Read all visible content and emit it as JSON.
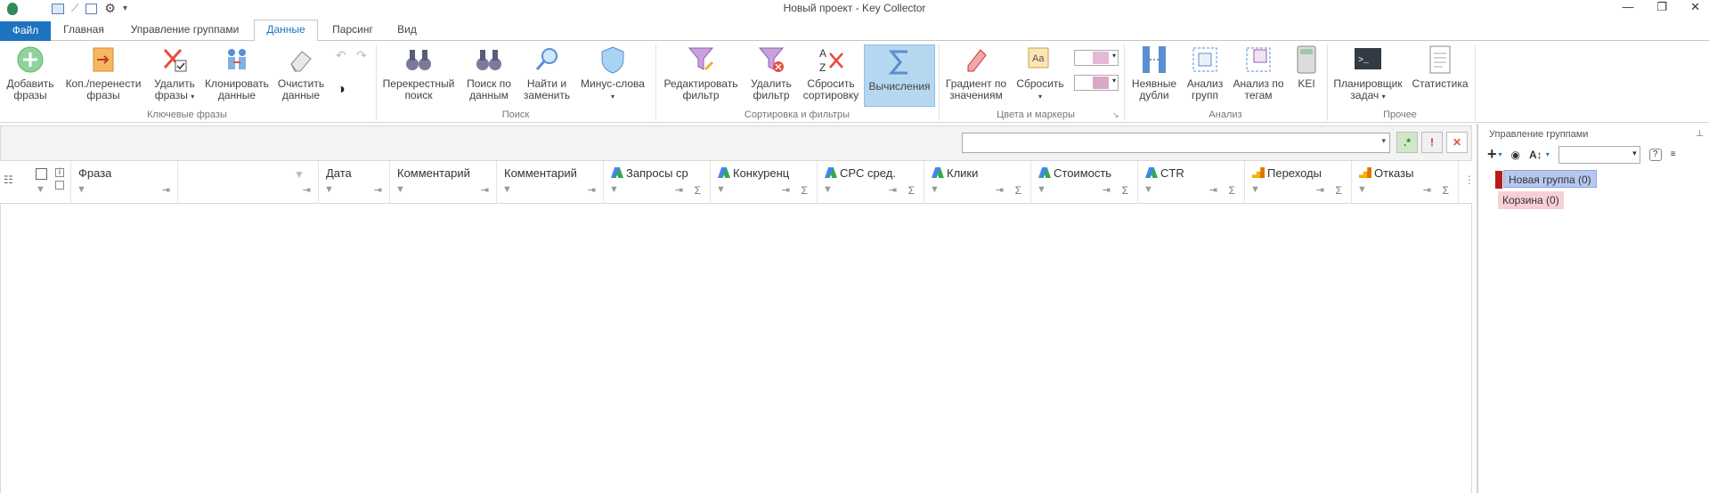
{
  "window": {
    "title": "Новый проект - Key Collector",
    "controls": [
      "—",
      "❐",
      "✕"
    ]
  },
  "tabs": [
    "Файл",
    "Главная",
    "Управление группами",
    "Данные",
    "Парсинг",
    "Вид"
  ],
  "ribbon": {
    "buttons": [
      {
        "label": "Добавить фразы",
        "icon": "add-icon"
      },
      {
        "label": "Коп./перенести фразы",
        "icon": "copy-move-icon"
      },
      {
        "label": "Удалить фразы",
        "icon": "delete-icon"
      },
      {
        "label": "Клонировать данные",
        "icon": "clone-icon"
      },
      {
        "label": "Очистить данные",
        "icon": "eraser-icon"
      },
      {
        "label": "Перекрестный поиск",
        "icon": "binoculars-icon"
      },
      {
        "label": "Поиск по данным",
        "icon": "binoculars-icon"
      },
      {
        "label": "Найти и заменить",
        "icon": "magnifier-icon"
      },
      {
        "label": "Минус-слова",
        "icon": "shield-icon"
      },
      {
        "label": "Редактировать фильтр",
        "icon": "filter-edit-icon"
      },
      {
        "label": "Удалить фильтр",
        "icon": "filter-remove-icon"
      },
      {
        "label": "Сбросить сортировку",
        "icon": "sort-reset-icon"
      },
      {
        "label": "Вычисления",
        "icon": "sigma-icon"
      },
      {
        "label": "Градиент по значениям",
        "icon": "gradient-icon"
      },
      {
        "label": "Сбросить",
        "icon": "reset-color-icon"
      },
      {
        "label": "Неявные дубли",
        "icon": "duplicates-icon"
      },
      {
        "label": "Анализ групп",
        "icon": "group-analysis-icon"
      },
      {
        "label": "Анализ по тегам",
        "icon": "tag-analysis-icon"
      },
      {
        "label": "KEI",
        "icon": "calculator-icon"
      },
      {
        "label": "Планировщик задач",
        "icon": "terminal-icon"
      },
      {
        "label": "Статистика",
        "icon": "document-icon"
      }
    ],
    "groups": [
      "Ключевые фразы",
      "Поиск",
      "Сортировка и фильтры",
      "Цвета и маркеры",
      "Анализ",
      "Прочее"
    ]
  },
  "columns": [
    {
      "label": "Фраза",
      "source": ""
    },
    {
      "label": "",
      "source": ""
    },
    {
      "label": "Дата",
      "source": ""
    },
    {
      "label": "Комментарий",
      "source": ""
    },
    {
      "label": "Комментарий",
      "source": ""
    },
    {
      "label": "Запросы ср",
      "source": "ads"
    },
    {
      "label": "Конкуренц",
      "source": "ads"
    },
    {
      "label": "CPC сред.",
      "source": "ads"
    },
    {
      "label": "Клики",
      "source": "ads"
    },
    {
      "label": "Стоимость",
      "source": "ads"
    },
    {
      "label": "CTR",
      "source": "ads"
    },
    {
      "label": "Переходы",
      "source": "analytics"
    },
    {
      "label": "Отказы",
      "source": "analytics"
    }
  ],
  "right_panel": {
    "title": "Управление группами",
    "groups": [
      {
        "label": "Новая группа (0)",
        "color": "#a8c0ee",
        "marker": "#b71c1c"
      },
      {
        "label": "Корзина (0)",
        "color": "#f6d0d6"
      }
    ]
  }
}
